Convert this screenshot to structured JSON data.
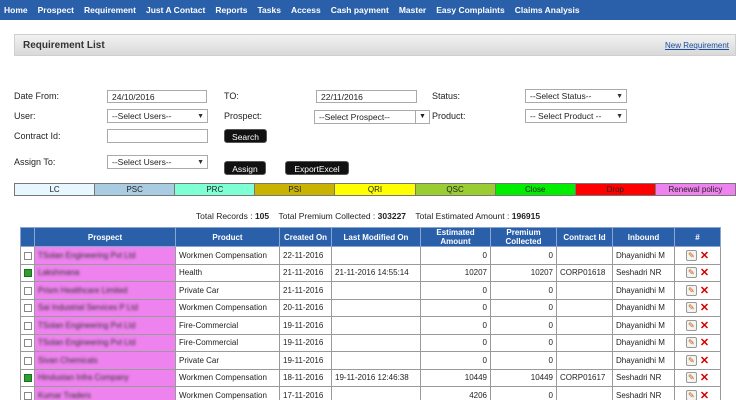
{
  "nav": [
    "Home",
    "Prospect",
    "Requirement",
    "Just A Contact",
    "Reports",
    "Tasks",
    "Access",
    "Cash payment",
    "Master",
    "Easy Complaints",
    "Claims Analysis"
  ],
  "page": {
    "title": "Requirement List",
    "new_link": "New Requirement"
  },
  "filters": {
    "date_from_label": "Date From:",
    "date_from": "24/10/2016",
    "to_label": "TO:",
    "to": "22/11/2016",
    "status_label": "Status:",
    "status": "--Select Status--",
    "user_label": "User:",
    "user": "--Select Users--",
    "prospect_label": "Prospect:",
    "prospect": "--Select Prospect--",
    "product_label": "Product:",
    "product": "-- Select Product --",
    "contract_label": "Contract Id:",
    "contract": "",
    "assign_label": "Assign To:",
    "assign": "--Select Users--",
    "search_btn": "Search",
    "assign_btn": "Assign",
    "export_btn": "ExportExcel"
  },
  "legend": [
    {
      "label": "LC",
      "color": "#e8f6ff"
    },
    {
      "label": "PSC",
      "color": "#a9cce3"
    },
    {
      "label": "PRC",
      "color": "#7fffd4"
    },
    {
      "label": "PSI",
      "color": "#c8b400"
    },
    {
      "label": "QRI",
      "color": "#ffff00"
    },
    {
      "label": "QSC",
      "color": "#9acd32"
    },
    {
      "label": "Close",
      "color": "#00ee00"
    },
    {
      "label": "Drop",
      "color": "#ff0000"
    },
    {
      "label": "Renewal policy",
      "color": "#ee82ee"
    }
  ],
  "totals": {
    "records_label": "Total Records :",
    "records": "105",
    "premium_label": "Total Premium Collected :",
    "premium": "303227",
    "estimated_label": "Total Estimated Amount :",
    "estimated": "196915"
  },
  "table": {
    "headers": [
      "",
      "Prospect",
      "Product",
      "Created On",
      "Last Modified On",
      "Estimated Amount",
      "Premium Collected",
      "Contract Id",
      "Inbound",
      "#"
    ],
    "rows": [
      {
        "checked": false,
        "prospect": "TSolan Engineering Pvt Ltd",
        "product": "Workmen Compensation",
        "created": "22-11-2016",
        "modified": "",
        "estimated": "0",
        "premium": "0",
        "contract": "",
        "inbound": "Dhayanidhi M"
      },
      {
        "checked": true,
        "prospect": "Lakshmana",
        "product": "Health",
        "created": "21-11-2016",
        "modified": "21-11-2016 14:55:14",
        "estimated": "10207",
        "premium": "10207",
        "contract": "CORP01618",
        "inbound": "Seshadri NR"
      },
      {
        "checked": false,
        "prospect": "Prism Healthcare Limited",
        "product": "Private Car",
        "created": "21-11-2016",
        "modified": "",
        "estimated": "0",
        "premium": "0",
        "contract": "",
        "inbound": "Dhayanidhi M"
      },
      {
        "checked": false,
        "prospect": "Sai Industrial Services P Ltd",
        "product": "Workmen Compensation",
        "created": "20-11-2016",
        "modified": "",
        "estimated": "0",
        "premium": "0",
        "contract": "",
        "inbound": "Dhayanidhi M"
      },
      {
        "checked": false,
        "prospect": "TSolan Engineering Pvt Ltd",
        "product": "Fire-Commercial",
        "created": "19-11-2016",
        "modified": "",
        "estimated": "0",
        "premium": "0",
        "contract": "",
        "inbound": "Dhayanidhi M"
      },
      {
        "checked": false,
        "prospect": "TSolan Engineering Pvt Ltd",
        "product": "Fire-Commercial",
        "created": "19-11-2016",
        "modified": "",
        "estimated": "0",
        "premium": "0",
        "contract": "",
        "inbound": "Dhayanidhi M"
      },
      {
        "checked": false,
        "prospect": "Sivan Chemicals",
        "product": "Private Car",
        "created": "19-11-2016",
        "modified": "",
        "estimated": "0",
        "premium": "0",
        "contract": "",
        "inbound": "Dhayanidhi M"
      },
      {
        "checked": true,
        "prospect": "Hindustan Infra Company",
        "product": "Workmen Compensation",
        "created": "18-11-2016",
        "modified": "19-11-2016 12:46:38",
        "estimated": "10449",
        "premium": "10449",
        "contract": "CORP01617",
        "inbound": "Seshadri NR"
      },
      {
        "checked": false,
        "prospect": "Kumar Traders",
        "product": "Workmen Compensation",
        "created": "17-11-2016",
        "modified": "",
        "estimated": "4206",
        "premium": "0",
        "contract": "",
        "inbound": "Seshadri NR"
      }
    ]
  }
}
